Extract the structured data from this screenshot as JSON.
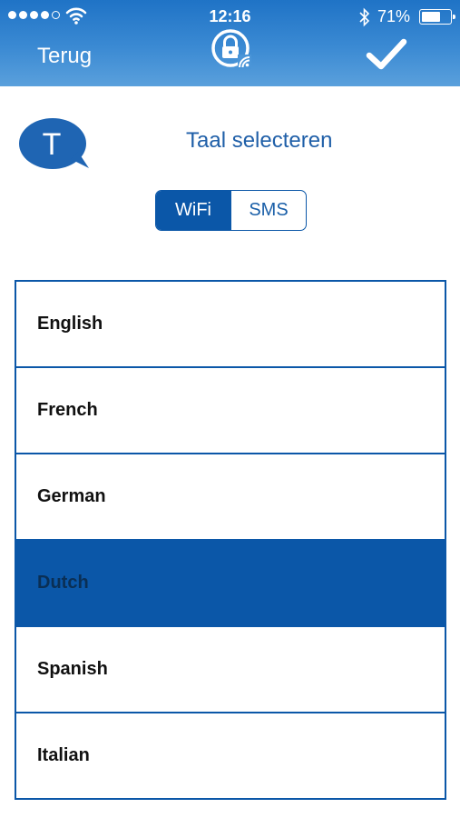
{
  "status_bar": {
    "time": "12:16",
    "battery_percent": "71%",
    "battery_level": 0.71,
    "signal_bars_filled": 4,
    "signal_bars_total": 5
  },
  "header": {
    "back_label": "Terug",
    "logo_icon": "lock-wifi-icon",
    "confirm_icon": "checkmark-icon"
  },
  "title": {
    "bubble_letter": "T",
    "text": "Taal selecteren"
  },
  "segmented": {
    "options": [
      "WiFi",
      "SMS"
    ],
    "selected": "WiFi"
  },
  "languages": {
    "items": [
      "English",
      "French",
      "German",
      "Dutch",
      "Spanish",
      "Italian"
    ],
    "selected": "Dutch"
  },
  "colors": {
    "primary": "#0b57a8",
    "header_top": "#1f73c6",
    "header_bottom": "#5aa0dc",
    "title_text": "#1f5fa8"
  }
}
